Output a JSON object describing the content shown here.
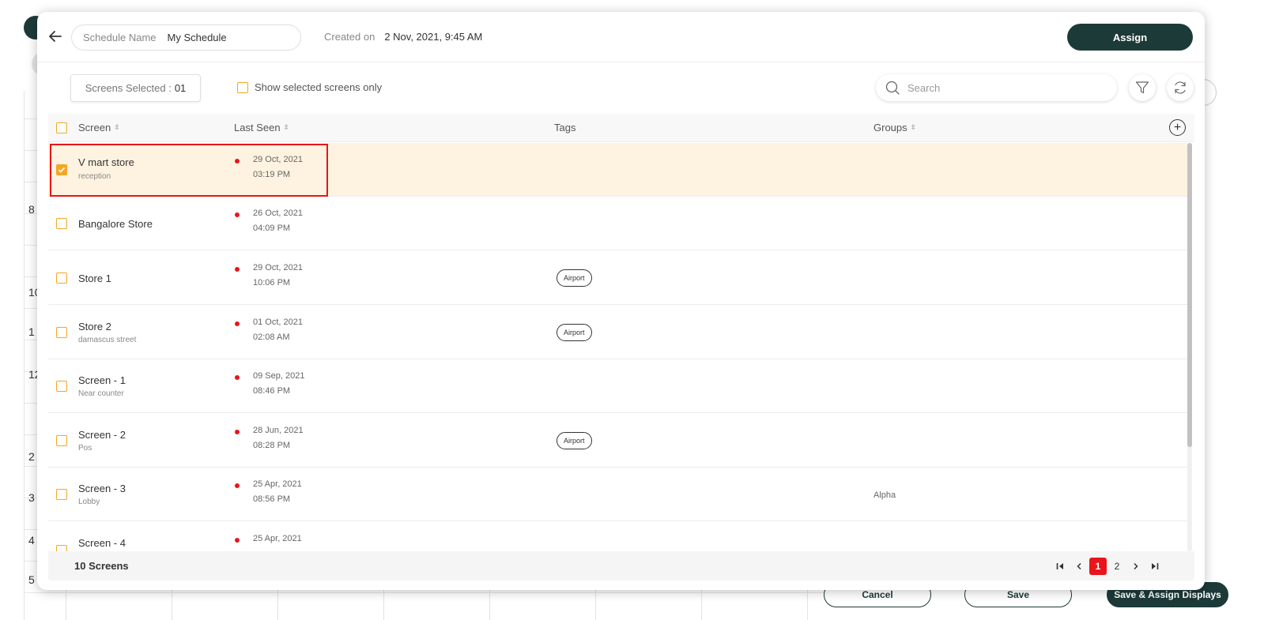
{
  "background": {
    "row_numbers": [
      "8",
      "10",
      "1",
      "12",
      "2",
      "3",
      "4",
      "5"
    ],
    "footer": {
      "cancel_label": "Cancel",
      "save_label": "Save",
      "save_assign_label": "Save & Assign Displays"
    }
  },
  "header": {
    "schedule_name_label": "Schedule Name",
    "schedule_name_value": "My Schedule",
    "created_on_label": "Created on",
    "created_on_value": "2 Nov, 2021, 9:45 AM",
    "assign_label": "Assign"
  },
  "toolbar": {
    "screens_selected_label": "Screens Selected :",
    "screens_selected_count": "01",
    "show_selected_label": "Show selected screens only",
    "search_placeholder": "Search"
  },
  "table": {
    "columns": {
      "screen": "Screen",
      "last_seen": "Last Seen",
      "tags": "Tags",
      "groups": "Groups"
    },
    "rows": [
      {
        "name": "V mart store",
        "sub": "reception",
        "date": "29 Oct, 2021",
        "time": "03:19 PM",
        "tag": "",
        "group": "",
        "checked": true
      },
      {
        "name": "Bangalore Store",
        "sub": "",
        "date": "26 Oct, 2021",
        "time": "04:09 PM",
        "tag": "",
        "group": "",
        "checked": false
      },
      {
        "name": "Store 1",
        "sub": "",
        "date": "29 Oct, 2021",
        "time": "10:06 PM",
        "tag": "Airport",
        "group": "",
        "checked": false
      },
      {
        "name": "Store 2",
        "sub": "damascus street",
        "date": "01 Oct, 2021",
        "time": "02:08 AM",
        "tag": "Airport",
        "group": "",
        "checked": false
      },
      {
        "name": "Screen - 1",
        "sub": "Near counter",
        "date": "09 Sep, 2021",
        "time": "08:46 PM",
        "tag": "",
        "group": "",
        "checked": false
      },
      {
        "name": "Screen - 2",
        "sub": "Pos",
        "date": "28 Jun, 2021",
        "time": "08:28 PM",
        "tag": "Airport",
        "group": "",
        "checked": false
      },
      {
        "name": "Screen - 3",
        "sub": "Lobby",
        "date": "25 Apr, 2021",
        "time": "08:56 PM",
        "tag": "",
        "group": "Alpha",
        "checked": false
      },
      {
        "name": "Screen - 4",
        "sub": "",
        "date": "25 Apr, 2021",
        "time": "",
        "tag": "",
        "group": "",
        "checked": false
      }
    ]
  },
  "footer": {
    "count_label": "10 Screens",
    "pages": [
      "1",
      "2"
    ],
    "active_page": "1"
  },
  "colors": {
    "primary": "#1c3a38",
    "checkbox": "#f5a623",
    "selected_row": "#fef3e0",
    "status_offline": "#e8151b",
    "highlight": "#e8151b"
  },
  "icons": [
    "back-arrow-icon",
    "search-icon",
    "filter-icon",
    "refresh-icon",
    "sort-icon",
    "add-column-icon",
    "checkmark-icon",
    "first-page-icon",
    "prev-page-icon",
    "next-page-icon",
    "last-page-icon"
  ]
}
